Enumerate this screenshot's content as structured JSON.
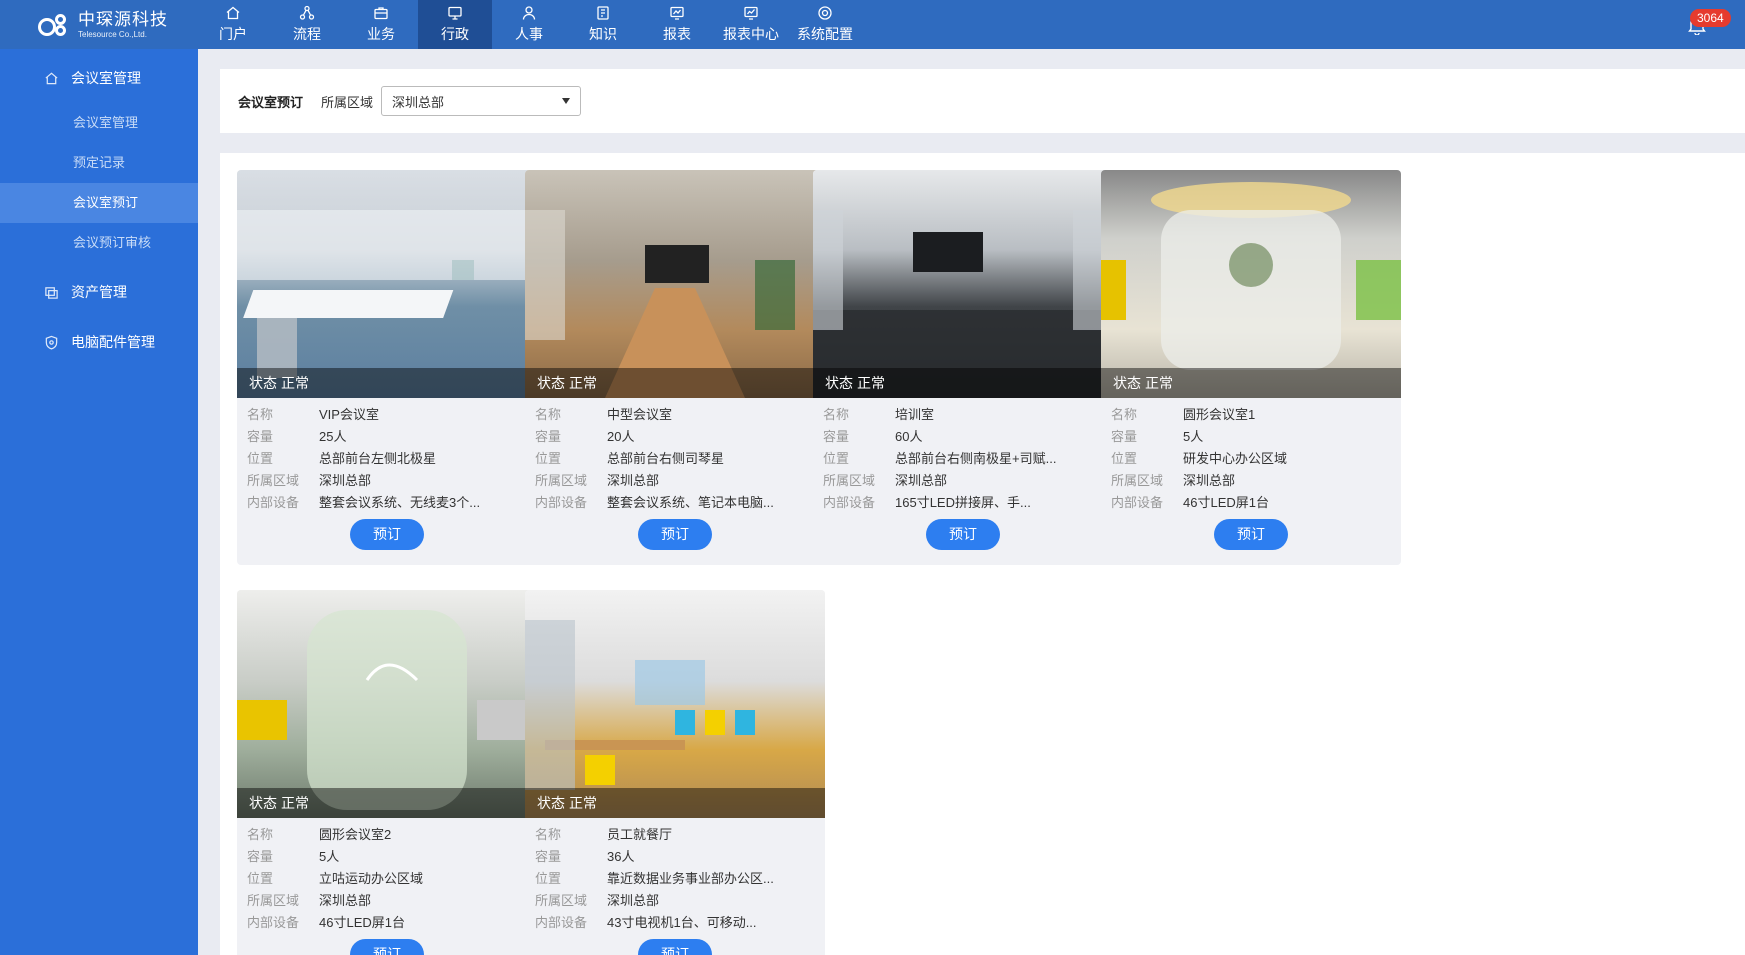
{
  "brand": {
    "cn": "中琛源科技",
    "en": "Telesource Co.,Ltd."
  },
  "nav": [
    {
      "label": "门户",
      "icon": "home-icon"
    },
    {
      "label": "流程",
      "icon": "workflow-icon"
    },
    {
      "label": "业务",
      "icon": "briefcase-icon"
    },
    {
      "label": "行政",
      "icon": "monitor-icon",
      "active": true
    },
    {
      "label": "人事",
      "icon": "person-icon"
    },
    {
      "label": "知识",
      "icon": "book-icon"
    },
    {
      "label": "报表",
      "icon": "report-icon"
    },
    {
      "label": "报表中心",
      "icon": "chart-icon"
    },
    {
      "label": "系统配置",
      "icon": "settings-icon"
    }
  ],
  "notifications": {
    "count": "3064"
  },
  "sidebar": {
    "groups": [
      {
        "label": "会议室管理",
        "icon": "home-icon",
        "items": [
          {
            "label": "会议室管理"
          },
          {
            "label": "预定记录"
          },
          {
            "label": "会议室预订",
            "active": true
          },
          {
            "label": "会议预订审核"
          }
        ]
      },
      {
        "label": "资产管理",
        "icon": "asset-icon"
      },
      {
        "label": "电脑配件管理",
        "icon": "shield-icon"
      }
    ]
  },
  "filter": {
    "title": "会议室预订",
    "region_label": "所属区域",
    "region_value": "深圳总部"
  },
  "card_labels": {
    "status": "状态",
    "name": "名称",
    "capacity": "容量",
    "location": "位置",
    "region": "所属区域",
    "equipment": "内部设备",
    "book_button": "预订"
  },
  "rooms": [
    {
      "status": "正常",
      "name": "VIP会议室",
      "capacity": "25人",
      "location": "总部前台左侧北极星",
      "region": "深圳总部",
      "equipment": "整套会议系统、无线麦3个..."
    },
    {
      "status": "正常",
      "name": "中型会议室",
      "capacity": "20人",
      "location": "总部前台右侧司琴星",
      "region": "深圳总部",
      "equipment": "整套会议系统、笔记本电脑..."
    },
    {
      "status": "正常",
      "name": "培训室",
      "capacity": "60人",
      "location": "总部前台右侧南极星+司赋...",
      "region": "深圳总部",
      "equipment": "165寸LED拼接屏、手..."
    },
    {
      "status": "正常",
      "name": "圆形会议室1",
      "capacity": "5人",
      "location": "研发中心办公区域",
      "region": "深圳总部",
      "equipment": "46寸LED屏1台"
    },
    {
      "status": "正常",
      "name": "圆形会议室2",
      "capacity": "5人",
      "location": "立咕运动办公区域",
      "region": "深圳总部",
      "equipment": "46寸LED屏1台"
    },
    {
      "status": "正常",
      "name": "员工就餐厅",
      "capacity": "36人",
      "location": "靠近数据业务事业部办公区...",
      "region": "深圳总部",
      "equipment": "43寸电视机1台、可移动..."
    }
  ]
}
